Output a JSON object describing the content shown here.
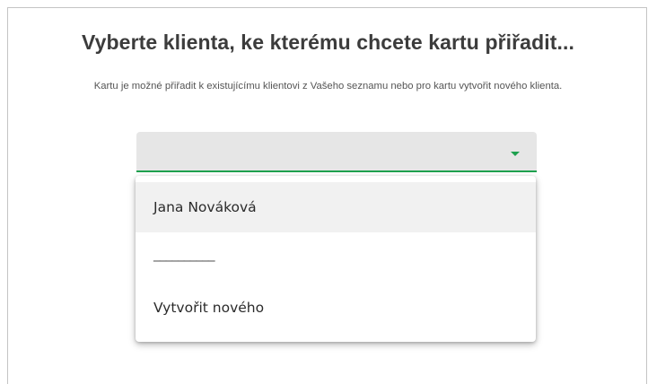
{
  "dialog": {
    "title": "Vyberte klienta, ke kterému chcete kartu přiřadit...",
    "subtitle": "Kartu je možné přiřadit k existujícímu klientovi z Vašeho seznamu nebo pro kartu vytvořit nového klienta."
  },
  "client_select": {
    "selected_value": "",
    "arrow_icon": "caret-down-icon",
    "accent_color": "#1ea14f"
  },
  "menu": {
    "items": [
      {
        "label": "Jana Nováková"
      },
      {
        "label": "__________"
      },
      {
        "label": "Vytvořit nového"
      }
    ]
  }
}
